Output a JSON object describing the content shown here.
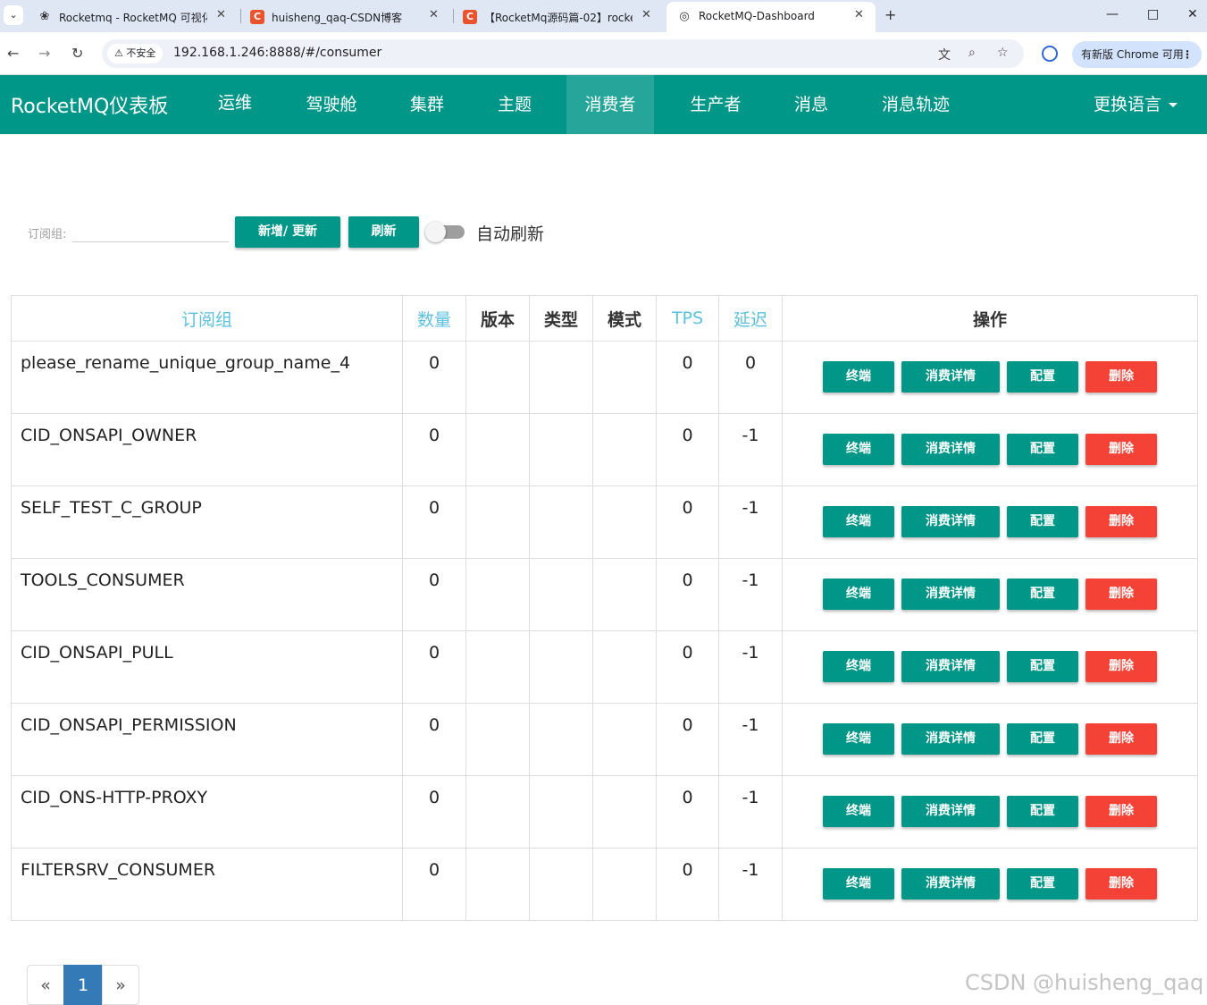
{
  "browser": {
    "tabs": [
      {
        "title": "Rocketmq - RocketMQ 可视化",
        "favicon": "openai-icon"
      },
      {
        "title": "huisheng_qaq-CSDN博客",
        "favicon": "csdn-icon"
      },
      {
        "title": "【RocketMq源码篇-02】rocke",
        "favicon": "csdn-icon"
      },
      {
        "title": "RocketMQ-Dashboard",
        "favicon": "globe-icon"
      }
    ],
    "insecure_label": "不安全",
    "url": "192.168.1.246:8888/#/consumer",
    "update_label": "有新版 Chrome 可用"
  },
  "navbar": {
    "brand": "RocketMQ仪表板",
    "items": [
      "运维",
      "驾驶舱",
      "集群",
      "主题",
      "消费者",
      "生产者",
      "消息",
      "消息轨迹"
    ],
    "active_index": 4,
    "language": "更换语言"
  },
  "toolbar": {
    "search_label": "订阅组:",
    "search_value": "",
    "add_update_label": "新增/ 更新",
    "refresh_label": "刷新",
    "auto_refresh_label": "自动刷新",
    "auto_refresh_on": false
  },
  "table": {
    "headers": [
      "订阅组",
      "数量",
      "版本",
      "类型",
      "模式",
      "TPS",
      "延迟",
      "操作"
    ],
    "action_labels": {
      "client": "终端",
      "detail": "消费详情",
      "config": "配置",
      "delete": "删除"
    },
    "rows": [
      {
        "group": "please_rename_unique_group_name_4",
        "count": "0",
        "version": "",
        "type": "",
        "mode": "",
        "tps": "0",
        "delay": "0"
      },
      {
        "group": "CID_ONSAPI_OWNER",
        "count": "0",
        "version": "",
        "type": "",
        "mode": "",
        "tps": "0",
        "delay": "-1"
      },
      {
        "group": "SELF_TEST_C_GROUP",
        "count": "0",
        "version": "",
        "type": "",
        "mode": "",
        "tps": "0",
        "delay": "-1"
      },
      {
        "group": "TOOLS_CONSUMER",
        "count": "0",
        "version": "",
        "type": "",
        "mode": "",
        "tps": "0",
        "delay": "-1"
      },
      {
        "group": "CID_ONSAPI_PULL",
        "count": "0",
        "version": "",
        "type": "",
        "mode": "",
        "tps": "0",
        "delay": "-1"
      },
      {
        "group": "CID_ONSAPI_PERMISSION",
        "count": "0",
        "version": "",
        "type": "",
        "mode": "",
        "tps": "0",
        "delay": "-1"
      },
      {
        "group": "CID_ONS-HTTP-PROXY",
        "count": "0",
        "version": "",
        "type": "",
        "mode": "",
        "tps": "0",
        "delay": "-1"
      },
      {
        "group": "FILTERSRV_CONSUMER",
        "count": "0",
        "version": "",
        "type": "",
        "mode": "",
        "tps": "0",
        "delay": "-1"
      }
    ]
  },
  "pagination": {
    "prev": "«",
    "current": "1",
    "next": "»"
  },
  "watermark": "CSDN @huisheng_qaq",
  "colors": {
    "primary": "#009688",
    "nav_active": "#26a69a",
    "danger": "#f44336",
    "sortable_header": "#5bc0de",
    "page_active": "#337ab7"
  }
}
